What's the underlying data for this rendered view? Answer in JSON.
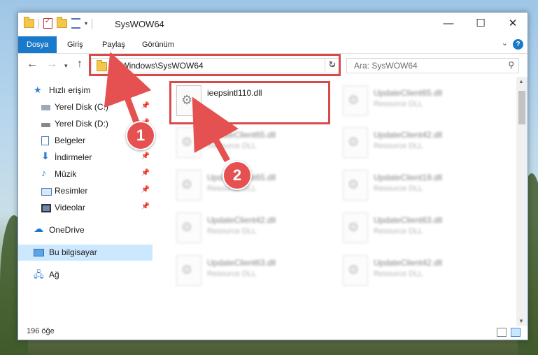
{
  "window": {
    "title": "SysWOW64"
  },
  "ribbon": {
    "tabs": [
      "Dosya",
      "Giriş",
      "Paylaş",
      "Görünüm"
    ],
    "help": "?"
  },
  "address": {
    "path": "C:\\Windows\\SysWOW64"
  },
  "search": {
    "placeholder": "Ara: SysWOW64"
  },
  "sidebar": {
    "items": [
      {
        "label": "Hızlı erişim"
      },
      {
        "label": "Yerel Disk (C:)"
      },
      {
        "label": "Yerel Disk (D:)"
      },
      {
        "label": "Belgeler"
      },
      {
        "label": "İndirmeler"
      },
      {
        "label": "Müzik"
      },
      {
        "label": "Resimler"
      },
      {
        "label": "Videolar"
      },
      {
        "label": "OneDrive"
      },
      {
        "label": "Bu bilgisayar"
      },
      {
        "label": "Ağ"
      }
    ]
  },
  "files": [
    {
      "name": "ieepsintl110.dll",
      "type": ""
    },
    {
      "name": "UpdateClient65.dll",
      "type": "Resource DLL"
    },
    {
      "name": "UpdateClient65.dll",
      "type": "Resource DLL"
    },
    {
      "name": "UpdateClient42.dll",
      "type": "Resource DLL"
    },
    {
      "name": "UpdateClient65.dll",
      "type": "Resource DLL"
    },
    {
      "name": "UpdateClient19.dll",
      "type": "Resource DLL"
    },
    {
      "name": "UpdateClient42.dll",
      "type": "Resource DLL"
    },
    {
      "name": "UpdateClient63.dll",
      "type": "Resource DLL"
    },
    {
      "name": "UpdateClient63.dll",
      "type": "Resource DLL"
    },
    {
      "name": "UpdateClient42.dll",
      "type": "Resource DLL"
    }
  ],
  "status": {
    "count": "196 öğe"
  },
  "annotations": {
    "step1": "1",
    "step2": "2"
  },
  "colors": {
    "accent": "#1979ca",
    "highlight": "#d94a4a",
    "selected": "#cce8ff"
  }
}
